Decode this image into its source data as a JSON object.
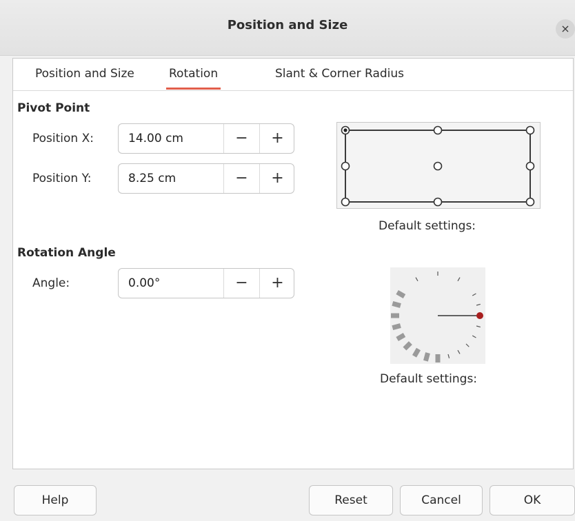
{
  "dialog": {
    "title": "Position and Size",
    "close_glyph": "×"
  },
  "tabs": [
    {
      "label": "Position and Size"
    },
    {
      "label": "Rotation",
      "active": true
    },
    {
      "label": "Slant & Corner Radius"
    }
  ],
  "pivot": {
    "heading": "Pivot Point",
    "x_label": "Position X:",
    "x_value": "14.00 cm",
    "y_label": "Position Y:",
    "y_value": "8.25 cm",
    "default_label": "Default settings:"
  },
  "rotation": {
    "heading": "Rotation Angle",
    "angle_label": "Angle:",
    "angle_value": "0.00°",
    "default_label": "Default settings:"
  },
  "spin": {
    "minus": "−",
    "plus": "+"
  },
  "buttons": {
    "help": "Help",
    "reset": "Reset",
    "cancel": "Cancel",
    "ok": "OK"
  },
  "colors": {
    "accent": "#e25e4b",
    "dial_marker": "#a81f1f"
  },
  "icons": {
    "close": "close-icon",
    "minus": "minus-icon",
    "plus": "plus-icon"
  }
}
